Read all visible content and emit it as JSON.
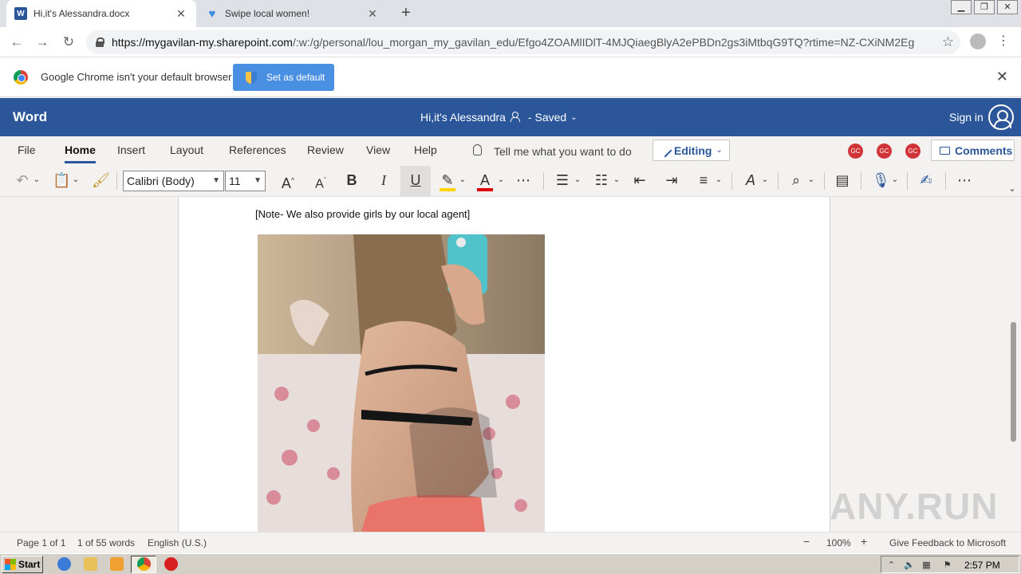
{
  "browser": {
    "tabs": [
      {
        "title": "Hi,it's Alessandra.docx",
        "favicon": "word-icon"
      },
      {
        "title": "Swipe local women!",
        "favicon": "heart-icon"
      }
    ],
    "url_host": "https://mygavilan-my.sharepoint.com",
    "url_path": "/:w:/g/personal/lou_morgan_my_gavilan_edu/Efgo4ZOAMlIDlT-4MJQiaegBlyA2ePBDn2gs3iMtbqG9TQ?rtime=NZ-CXiNM2Eg"
  },
  "infobar": {
    "message": "Google Chrome isn't your default browser",
    "button": "Set as default"
  },
  "word": {
    "app_name": "Word",
    "doc_title": "Hi,it's Alessandra",
    "saved_status": "- Saved",
    "sign_in": "Sign in",
    "tabs": [
      "File",
      "Home",
      "Insert",
      "Layout",
      "References",
      "Review",
      "View",
      "Help"
    ],
    "tell_me": "Tell me what you want to do",
    "editing": "Editing",
    "presence": [
      "GC",
      "GC",
      "GC"
    ],
    "comments": "Comments",
    "font_name": "Calibri (Body)",
    "font_size": "11"
  },
  "document": {
    "note": "[Note- We also provide girls by our local agent]"
  },
  "status": {
    "page": "Page 1 of 1",
    "words": "1 of 55 words",
    "language": "English (U.S.)",
    "zoom": "100%",
    "feedback": "Give Feedback to Microsoft"
  },
  "watermark": "ANY.RUN",
  "taskbar": {
    "start": "Start",
    "time": "2:57 PM"
  },
  "colors": {
    "word_blue": "#2b579a",
    "chrome_button": "#4a90e2",
    "presence_red": "#d13438"
  }
}
